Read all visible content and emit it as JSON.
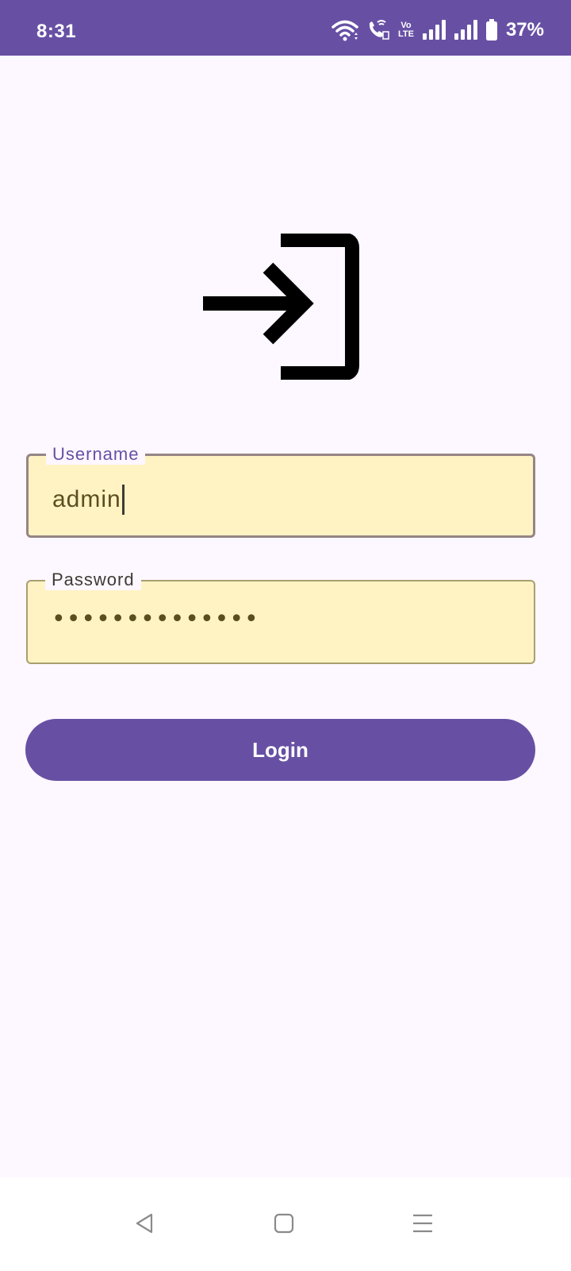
{
  "status_bar": {
    "time": "8:31",
    "volte_top": "Vo",
    "volte_bottom": "LTE",
    "battery_percent": "37%",
    "background_color": "#6750A4"
  },
  "icons": {
    "main": "login-icon",
    "status": [
      "wifi-icon",
      "wifi-calling-icon",
      "volte-icon",
      "signal-icon",
      "signal-icon",
      "battery-icon"
    ],
    "navigation": [
      "back-icon",
      "home-icon",
      "recents-icon"
    ]
  },
  "form": {
    "username": {
      "label": "Username",
      "value": "admin"
    },
    "password": {
      "label": "Password",
      "masked_value": "••••••••••••••"
    },
    "login_label": "Login"
  },
  "colors": {
    "accent": "#6750A4",
    "field_background": "#FFF3C4",
    "page_background": "#FDF7FF"
  }
}
